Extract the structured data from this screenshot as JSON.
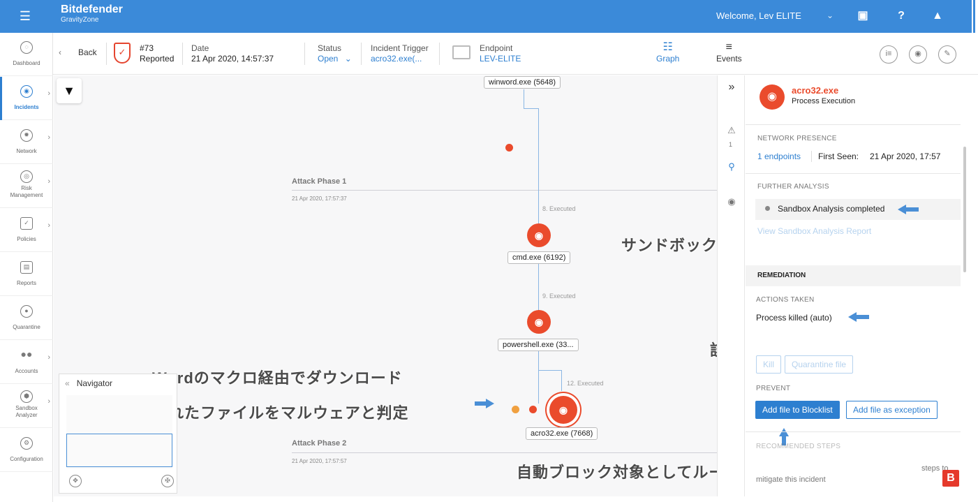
{
  "topbar": {
    "brand": "Bitdefender",
    "product": "GravityZone",
    "welcome": "Welcome, Lev ELITE"
  },
  "sidebar": {
    "items": [
      {
        "label": "Dashboard",
        "icon": "gauge-icon"
      },
      {
        "label": "Incidents",
        "icon": "incidents-icon",
        "active": true
      },
      {
        "label": "Network",
        "icon": "network-icon"
      },
      {
        "label": "Risk\nManagement",
        "icon": "risk-icon"
      },
      {
        "label": "Policies",
        "icon": "policies-icon"
      },
      {
        "label": "Reports",
        "icon": "reports-icon"
      },
      {
        "label": "Quarantine",
        "icon": "quarantine-icon"
      },
      {
        "label": "Accounts",
        "icon": "accounts-icon"
      },
      {
        "label": "Sandbox\nAnalyzer",
        "icon": "sandbox-icon"
      },
      {
        "label": "Configuration",
        "icon": "configuration-icon"
      }
    ]
  },
  "header": {
    "back": "Back",
    "incident_id": "#73",
    "incident_state": "Reported",
    "date_label": "Date",
    "date_value": "21 Apr 2020, 14:57:37",
    "status_label": "Status",
    "status_value": "Open",
    "trigger_label": "Incident Trigger",
    "trigger_value": "acro32.exe(...",
    "endpoint_label": "Endpoint",
    "endpoint_value": "LEV-ELITE",
    "tab_graph": "Graph",
    "tab_events": "Events"
  },
  "graph": {
    "nodes": {
      "winword": "winword.exe (5648)",
      "cmd": "cmd.exe (6192)",
      "powershell": "powershell.exe (33...",
      "acro": "acro32.exe (7668)"
    },
    "edges": {
      "e8": "8. Executed",
      "e9": "9. Executed",
      "e12": "12. Executed"
    },
    "phase1": {
      "title": "Attack Phase 1",
      "date": "21 Apr 2020, 17:57:37"
    },
    "phase2": {
      "title": "Attack Phase 2",
      "date": "21 Apr 2020, 17:57:57"
    }
  },
  "navigator": {
    "title": "Navigator"
  },
  "details": {
    "proc_name": "acro32.exe",
    "proc_type": "Process Execution",
    "network_presence_title": "NETWORK PRESENCE",
    "endpoints_link": "1 endpoints",
    "first_seen_label": "First Seen:",
    "first_seen_value": "21 Apr 2020, 17:57",
    "further_analysis_title": "FURTHER ANALYSIS",
    "sandbox_status": "Sandbox Analysis completed",
    "view_report": "View Sandbox Analysis Report",
    "remediation_title": "REMEDIATION",
    "actions_taken_title": "ACTIONS TAKEN",
    "action_value": "Process killed (auto)",
    "kill_btn": "Kill",
    "quarantine_btn": "Quarantine file",
    "prevent_title": "PREVENT",
    "blocklist_btn": "Add file to Blocklist",
    "exception_btn": "Add file as exception",
    "recommended_title": "RECOMMENDED STEPS",
    "recommended_text": "steps to",
    "recommended_text2": "mitigate this incident",
    "rail_badge": "1"
  },
  "annotations": {
    "sandbox": "サンドボックスに自動で送られ解析済",
    "kill": "該当プロセスは自動でKill済",
    "word1": "Wordのマクロ経由でダウンロード",
    "word2": "されたファイルをマルウェアと判定",
    "block": "自動ブロック対象としてルールに追加も可能",
    "badge": "B"
  },
  "colors": {
    "accent": "#3b8ad9",
    "danger": "#ea4b2c",
    "link": "#2d7fd0"
  }
}
